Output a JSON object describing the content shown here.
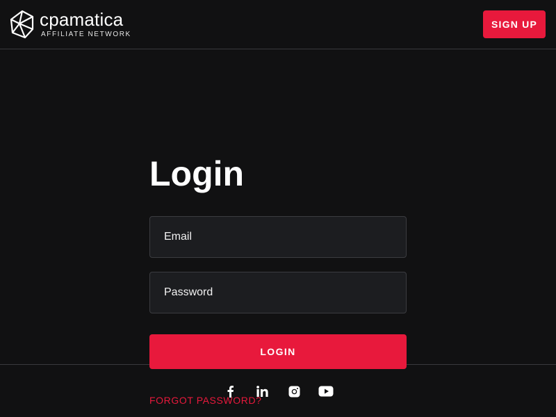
{
  "header": {
    "logo_name": "cpamatica",
    "logo_tagline": "AFFILIATE NETWORK",
    "signup_label": "SIGN UP"
  },
  "main": {
    "title": "Login",
    "email_placeholder": "Email",
    "password_placeholder": "Password",
    "login_label": "LOGIN",
    "forgot_label": "FORGOT PASSWORD?"
  },
  "footer": {
    "social_icons": [
      "facebook-icon",
      "linkedin-icon",
      "instagram-icon",
      "youtube-icon"
    ]
  },
  "colors": {
    "background": "#111112",
    "accent": "#e8193c",
    "field_background": "#1c1d20",
    "border": "#3a3a3d"
  }
}
